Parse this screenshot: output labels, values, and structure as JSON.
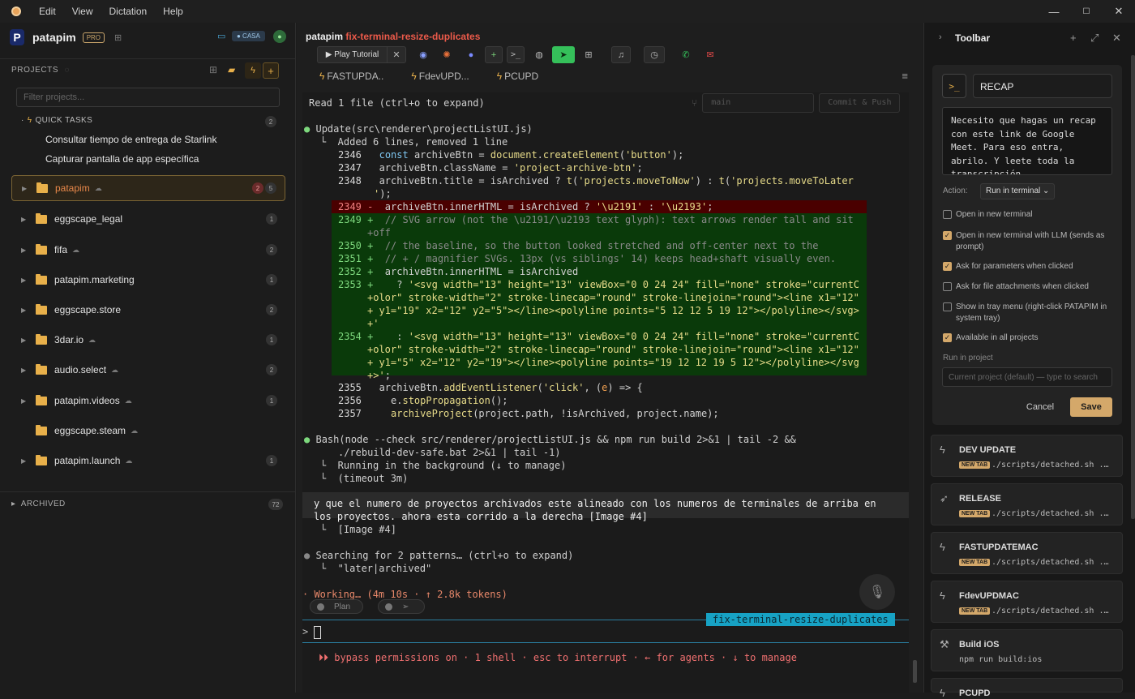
{
  "menubar": {
    "items": [
      "Edit",
      "View",
      "Dictation",
      "Help"
    ]
  },
  "window": {
    "minimize": "—",
    "maximize": "☐",
    "close": "✕"
  },
  "left": {
    "brand": "patapim",
    "pro_badge": "PRO",
    "env_badge": "● CASA",
    "projects_label": "PROJECTS",
    "filter_placeholder": "Filter projects...",
    "quick_tasks": {
      "label": "QUICK TASKS",
      "count": "2",
      "items": [
        "Consultar tiempo de entrega de Starlink",
        "Capturar pantalla de app específica"
      ]
    },
    "projects": [
      {
        "name": "patapim",
        "cloud": true,
        "active": true,
        "badge_red": "2",
        "badge": "5"
      },
      {
        "name": "eggscape_legal",
        "cloud": false,
        "badge": "1"
      },
      {
        "name": "fifa",
        "cloud": true,
        "badge": "2"
      },
      {
        "name": "patapim.marketing",
        "cloud": false,
        "badge": "1"
      },
      {
        "name": "eggscape.store",
        "cloud": false,
        "badge": "2"
      },
      {
        "name": "3dar.io",
        "cloud": true,
        "badge": "1"
      },
      {
        "name": "audio.select",
        "cloud": true,
        "badge": "2"
      },
      {
        "name": "patapim.videos",
        "cloud": true,
        "badge": "1"
      },
      {
        "name": "eggscape.steam",
        "cloud": true,
        "badge": ""
      },
      {
        "name": "patapim.launch",
        "cloud": true,
        "badge": "1"
      }
    ],
    "archived": {
      "label": "ARCHIVED",
      "count": "72"
    }
  },
  "mid": {
    "project": "patapim",
    "branch": "fix-terminal-resize-duplicates",
    "toolbar": {
      "play_tutorial": "▶  Play Tutorial"
    },
    "tabs": [
      "FASTUPDA..",
      "FdevUPD...",
      "PCUPD"
    ],
    "git": {
      "branch_select": "main",
      "commit": "Commit & Push"
    },
    "term": {
      "read": "Read 1 file (ctrl+o to expand)",
      "update_head": "Update(src\\renderer\\projectListUI.js)",
      "update_sub": "└  Added 6 lines, removed 1 line",
      "bash_head": "Bash(node --check src/renderer/projectListUI.js && npm run build 2>&1 | tail -2 &&",
      "bash_head2": "./rebuild-dev-safe.bat 2>&1 | tail -1)",
      "bash_sub1": "└  Running in the background (↓ to manage)",
      "bash_sub2": "└  (timeout 3m)",
      "user_msg1": "y que el numero de proyectos archivados este alineado con los numeros de terminales de arriba en",
      "user_msg2": "los proyectos. ahora esta corrido a la derecha [Image #4]",
      "user_sub": "└  [Image #4]",
      "search": "Searching for 2 patterns… (ctrl+o to expand)",
      "search_sub": "└  \"later|archived\"",
      "working": "· Working… (4m 10s · ↑ 2.8k tokens)",
      "branch_tag": "fix-terminal-resize-duplicates",
      "prompt": ">",
      "status": "⏵⏵ bypass permissions on · 1 shell · esc to interrupt · ← for agents · ↓ to manage",
      "plan": "Plan"
    }
  },
  "right": {
    "title": "Toolbar",
    "tool_icon": ">_",
    "name_value": "RECAP",
    "prompt_text": "Necesito que hagas un recap con este link de Google Meet. Para eso entra, abrilo. Y leete toda la transcripción",
    "action_label": "Action:",
    "action_value": "Run in terminal ⌄",
    "checks": [
      {
        "label": "Open in new terminal",
        "on": false
      },
      {
        "label": "Open in new terminal with LLM (sends as prompt)",
        "on": true
      },
      {
        "label": "Ask for parameters when clicked",
        "on": true
      },
      {
        "label": "Ask for file attachments when clicked",
        "on": false
      },
      {
        "label": "Show in tray menu (right-click PATAPIM in system tray)",
        "on": false
      },
      {
        "label": "Available in all projects",
        "on": true
      }
    ],
    "run_in_project": "Run in project",
    "run_placeholder": "Current project (default) — type to search",
    "cancel": "Cancel",
    "save": "Save",
    "shortcuts": [
      {
        "name": "DEV UPDATE",
        "new_tab": "NEW TAB",
        "cmd": "./scripts/detached.sh ...",
        "icon": "⚡"
      },
      {
        "name": "RELEASE",
        "new_tab": "NEW TAB",
        "cmd": "./scripts/detached.sh ...",
        "icon": "🚀"
      },
      {
        "name": "FASTUPDATEMAC",
        "new_tab": "NEW TAB",
        "cmd": "./scripts/detached.sh ...",
        "icon": "⚡"
      },
      {
        "name": "FdevUPDMAC",
        "new_tab": "NEW TAB",
        "cmd": "./scripts/detached.sh ...",
        "icon": "⚡"
      },
      {
        "name": "Build iOS",
        "new_tab": "",
        "cmd": "npm run build:ios",
        "icon": "🔨"
      },
      {
        "name": "PCUPD",
        "new_tab": "",
        "cmd": "",
        "icon": "⚡"
      }
    ]
  }
}
